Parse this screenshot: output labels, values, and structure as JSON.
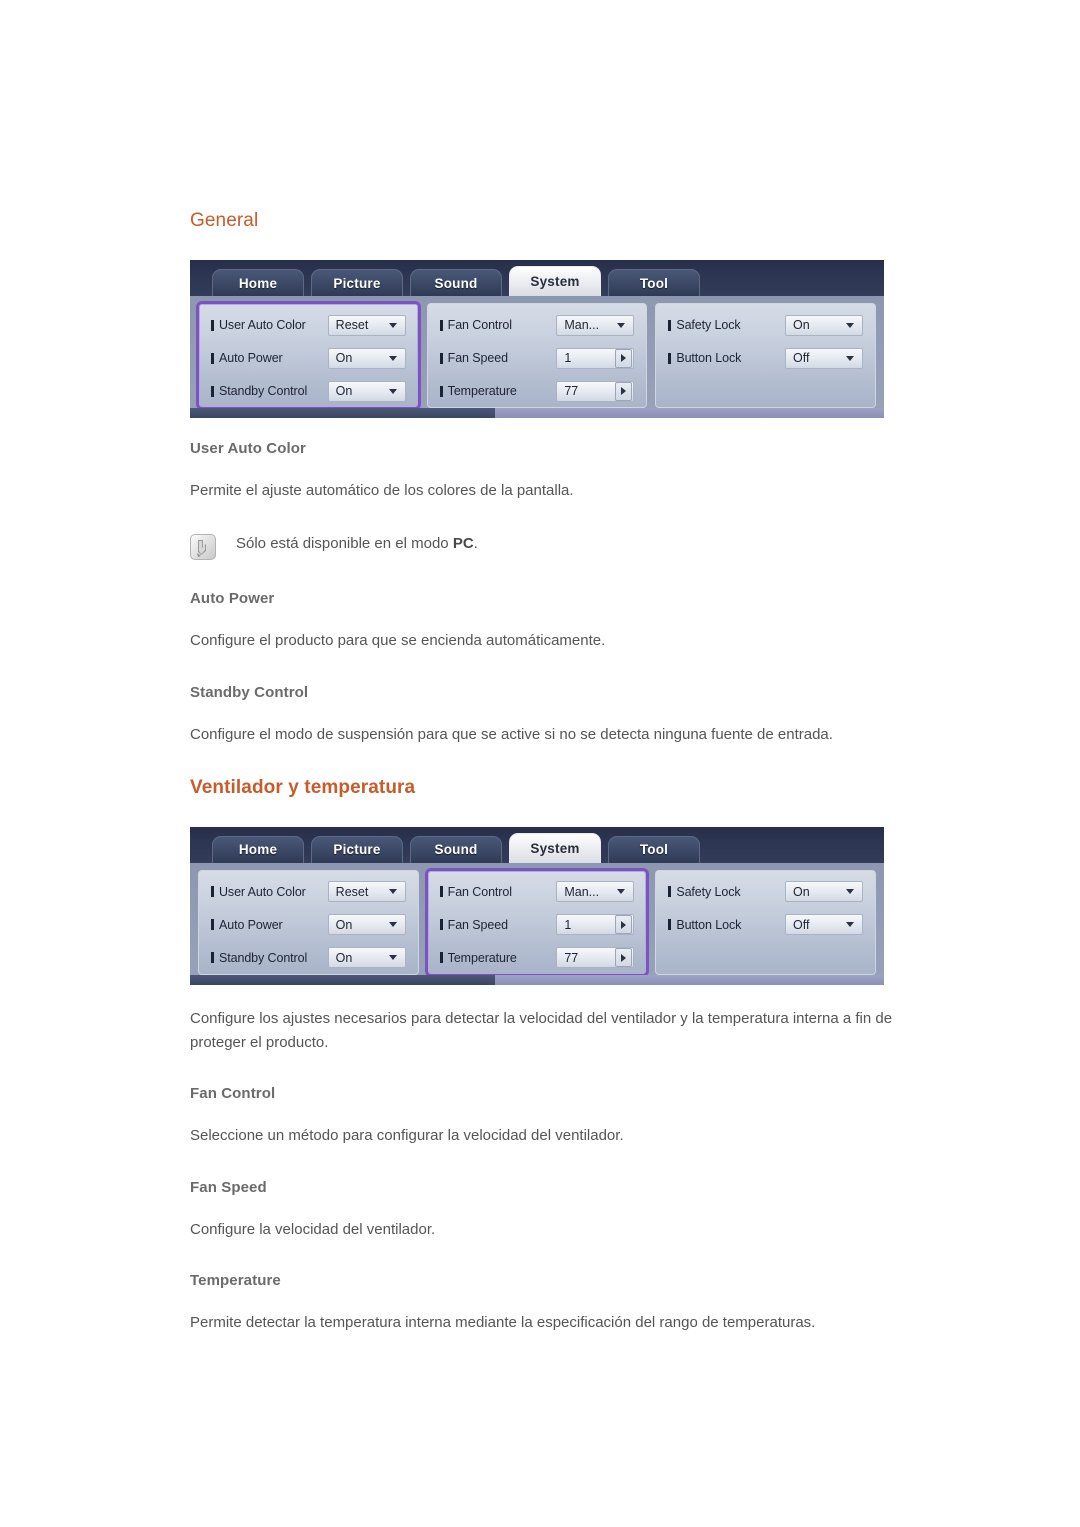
{
  "sections": [
    {
      "heading": "General",
      "heading_color": "#c75b2a",
      "heading_bold": false
    },
    {
      "heading": "Ventilador y temperatura",
      "heading_color": "#c75b2a",
      "heading_bold": true
    }
  ],
  "osd": {
    "tabs": [
      {
        "label": "Home",
        "active": false
      },
      {
        "label": "Picture",
        "active": false
      },
      {
        "label": "Sound",
        "active": false
      },
      {
        "label": "System",
        "active": true
      },
      {
        "label": "Tool",
        "active": false
      }
    ],
    "columns": [
      {
        "rows": [
          {
            "label": "User Auto Color",
            "value": "Reset",
            "control": "dropdown"
          },
          {
            "label": "Auto Power",
            "value": "On",
            "control": "dropdown"
          },
          {
            "label": "Standby Control",
            "value": "On",
            "control": "dropdown"
          }
        ]
      },
      {
        "rows": [
          {
            "label": "Fan Control",
            "value": "Man...",
            "control": "dropdown"
          },
          {
            "label": "Fan Speed",
            "value": "1",
            "control": "stepper"
          },
          {
            "label": "Temperature",
            "value": "77",
            "control": "stepper"
          }
        ]
      },
      {
        "rows": [
          {
            "label": "Safety Lock",
            "value": "On",
            "control": "dropdown"
          },
          {
            "label": "Button Lock",
            "value": "Off",
            "control": "dropdown"
          }
        ]
      }
    ],
    "highlight_color": "#7a55c2",
    "highlight_first": 0,
    "highlight_second": 1
  },
  "general": {
    "user_auto_color": {
      "title": "User Auto Color",
      "body": "Permite el ajuste automático de los colores de la pantalla.",
      "note_prefix": "Sólo está disponible en el modo ",
      "note_bold": "PC",
      "note_suffix": ".",
      "note_icon": "note-pencil-icon"
    },
    "auto_power": {
      "title": "Auto Power",
      "body": "Configure el producto para que se encienda automáticamente."
    },
    "standby_control": {
      "title": "Standby Control",
      "body": "Configure el modo de suspensión para que se active si no se detecta ninguna fuente de entrada."
    }
  },
  "fan": {
    "intro": "Configure los ajustes necesarios para detectar la velocidad del ventilador y la temperatura interna a fin de proteger el producto.",
    "fan_control": {
      "title": "Fan Control",
      "body": "Seleccione un método para configurar la velocidad del ventilador."
    },
    "fan_speed": {
      "title": "Fan Speed",
      "body": "Configure la velocidad del ventilador."
    },
    "temperature": {
      "title": "Temperature",
      "body": "Permite detectar la temperatura interna mediante la especificación del rango de temperaturas."
    }
  }
}
